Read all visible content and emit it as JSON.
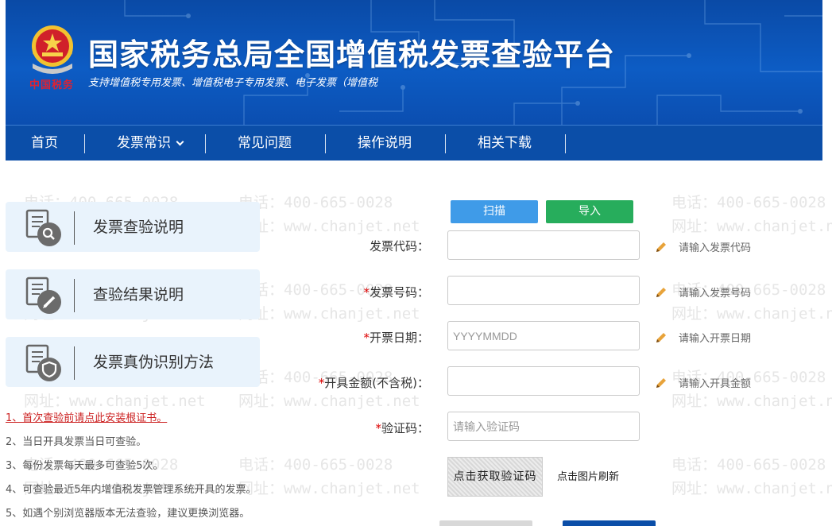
{
  "banner": {
    "title": "国家税务总局全国增值税发票查验平台",
    "subtitle": "支持增值税专用发票、增值税电子专用发票、电子发票（增值税",
    "seal_text": "中国税务"
  },
  "nav": {
    "items": [
      {
        "label": "首页"
      },
      {
        "label": "发票常识"
      },
      {
        "label": "常见问题"
      },
      {
        "label": "操作说明"
      },
      {
        "label": "相关下载"
      }
    ]
  },
  "watermark": {
    "phone": "电话：400-665-0028",
    "site": "网址：www.chanjet.net"
  },
  "cards": [
    {
      "label": "发票查验说明",
      "icon": "doc-search-icon"
    },
    {
      "label": "查验结果说明",
      "icon": "doc-edit-icon"
    },
    {
      "label": "发票真伪识别方法",
      "icon": "doc-shield-icon"
    }
  ],
  "notes": [
    "1、首次查验前请点此安装根证书。",
    "2、当日开具发票当日可查验。",
    "3、每份发票每天最多可查验5次。",
    "4、可查验最近5年内增值税发票管理系统开具的发票。",
    "5、如遇个别浏览器版本无法查验，建议更换浏览器。"
  ],
  "form": {
    "scan_label": "扫描",
    "import_label": "导入",
    "fields": [
      {
        "label": "发票代码：",
        "required": false,
        "placeholder": "",
        "hint": "请输入发票代码"
      },
      {
        "label": "发票号码：",
        "required": true,
        "placeholder": "",
        "hint": "请输入发票号码"
      },
      {
        "label": "开票日期：",
        "required": true,
        "placeholder": "YYYYMMDD",
        "hint": "请输入开票日期"
      },
      {
        "label": "开具金额(不含税)：",
        "required": true,
        "placeholder": "",
        "hint": "请输入开具金额"
      },
      {
        "label": "验证码：",
        "required": true,
        "placeholder": "请输入验证码",
        "hint": ""
      }
    ],
    "required_mark": "*",
    "captcha_text": "点击获取验证码",
    "refresh_label": "点击图片刷新"
  },
  "colors": {
    "banner_blue": "#0d5cc4",
    "nav_blue": "#0b4ea8",
    "scan_blue": "#3f9be8",
    "import_green": "#27ad5c",
    "required_red": "#d00"
  }
}
